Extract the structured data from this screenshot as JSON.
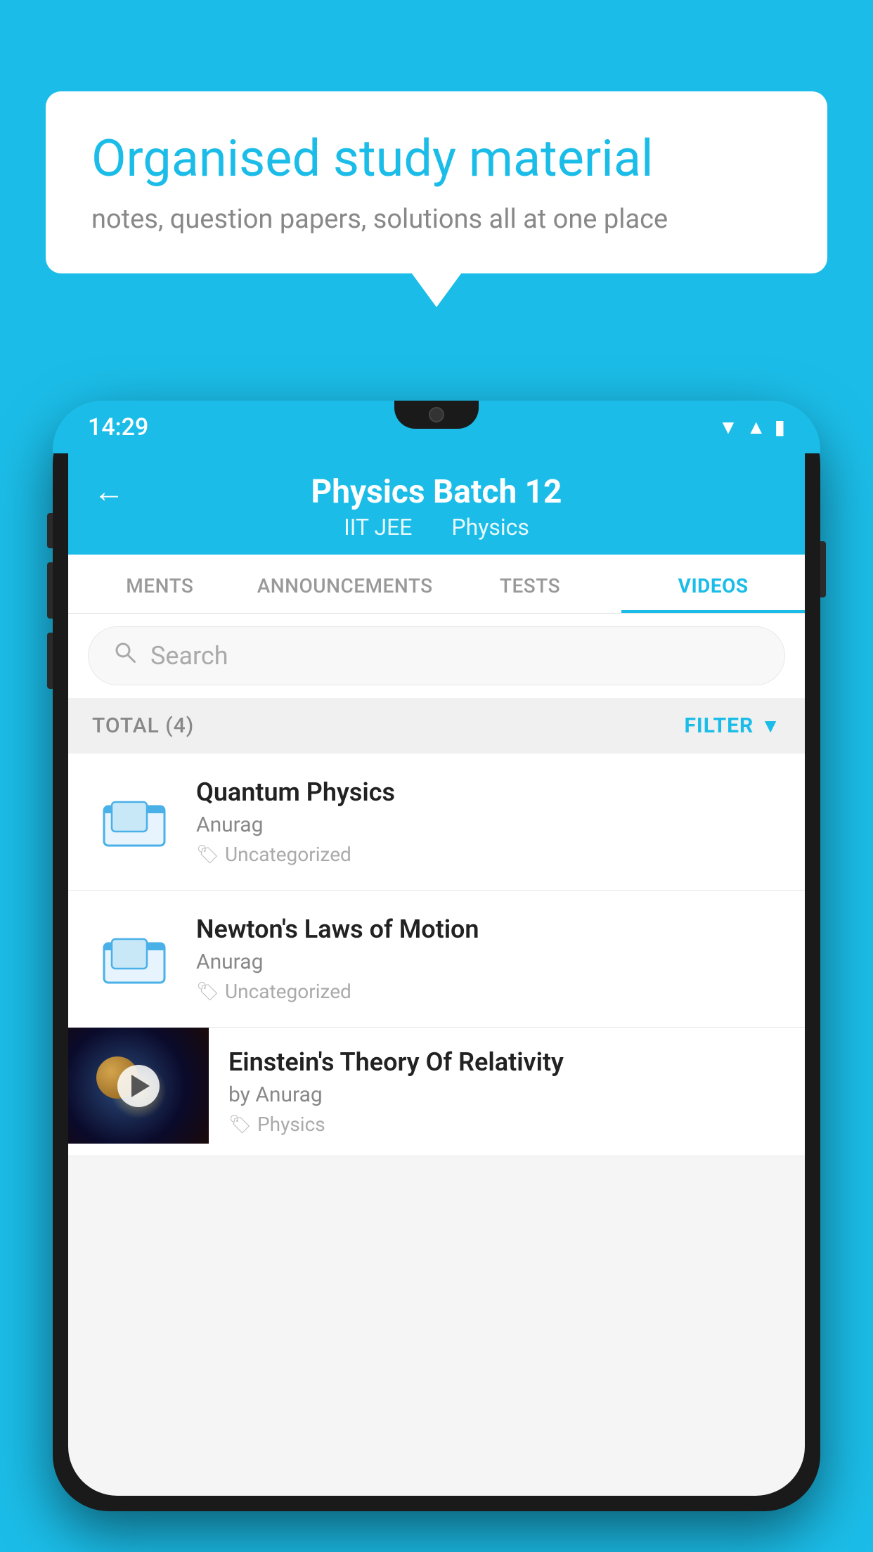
{
  "page": {
    "background_color": "#1BBDE8"
  },
  "bubble": {
    "title": "Organised study material",
    "subtitle": "notes, question papers, solutions all at one place"
  },
  "phone": {
    "status_bar": {
      "time": "14:29",
      "icons": [
        "wifi",
        "signal",
        "battery"
      ]
    },
    "header": {
      "back_label": "←",
      "title": "Physics Batch 12",
      "subtitle_part1": "IIT JEE",
      "subtitle_part2": "Physics"
    },
    "tabs": [
      {
        "label": "MENTS",
        "active": false
      },
      {
        "label": "ANNOUNCEMENTS",
        "active": false
      },
      {
        "label": "TESTS",
        "active": false
      },
      {
        "label": "VIDEOS",
        "active": true
      }
    ],
    "search": {
      "placeholder": "Search"
    },
    "filter_bar": {
      "total_label": "TOTAL (4)",
      "filter_label": "FILTER"
    },
    "videos": [
      {
        "title": "Quantum Physics",
        "author": "Anurag",
        "tag": "Uncategorized",
        "type": "folder",
        "has_thumbnail": false
      },
      {
        "title": "Newton's Laws of Motion",
        "author": "Anurag",
        "tag": "Uncategorized",
        "type": "folder",
        "has_thumbnail": false
      },
      {
        "title": "Einstein's Theory Of Relativity",
        "author": "by Anurag",
        "tag": "Physics",
        "type": "video",
        "has_thumbnail": true
      }
    ]
  }
}
